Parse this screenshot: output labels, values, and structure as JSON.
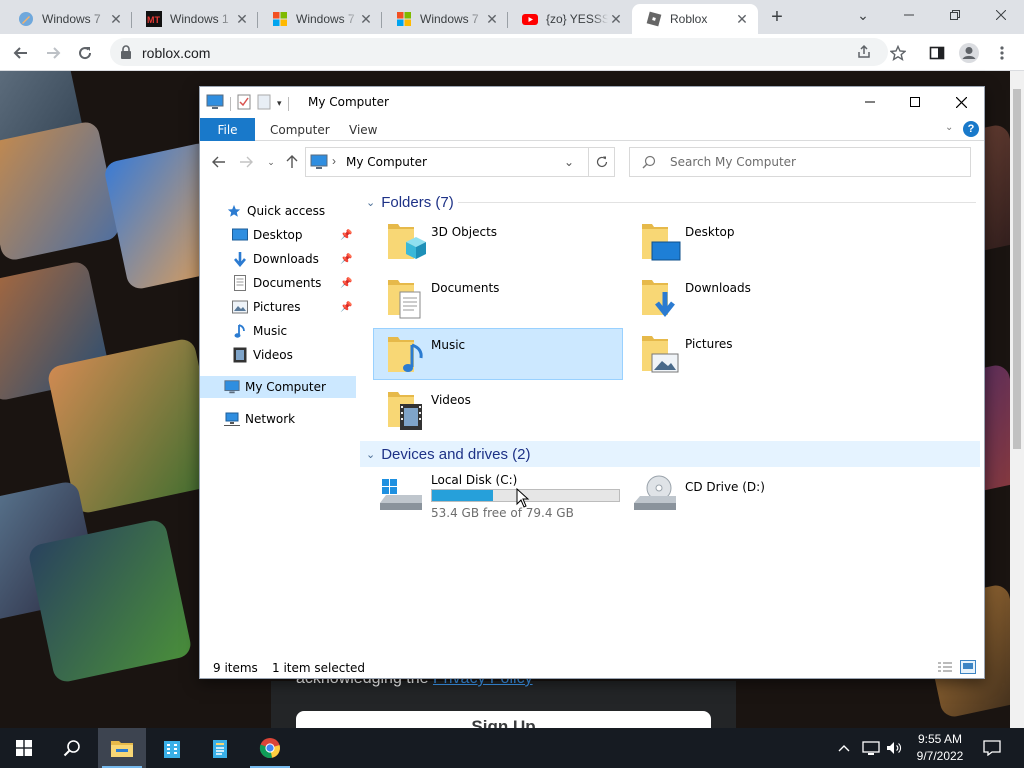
{
  "browser": {
    "tabs": [
      {
        "label": "Windows 7",
        "icon": "pencil-favicon-icon"
      },
      {
        "label": "Windows 1",
        "icon": "mt-favicon-icon"
      },
      {
        "label": "Windows 7",
        "icon": "windows-favicon-icon"
      },
      {
        "label": "Windows 7",
        "icon": "windows-favicon-icon"
      },
      {
        "label": "{zo} YESSS",
        "icon": "youtube-favicon-icon"
      },
      {
        "label": "Roblox",
        "icon": "roblox-favicon-icon",
        "active": true
      }
    ],
    "url": "roblox.com"
  },
  "page": {
    "signup_text": "acknowledging the ",
    "privacy_link": "Privacy Policy",
    "signup_button": "Sign Up"
  },
  "explorer": {
    "title": "My Computer",
    "ribbon_tabs": {
      "file": "File",
      "computer": "Computer",
      "view": "View"
    },
    "address": "My Computer",
    "search_placeholder": "Search My Computer",
    "nav": {
      "quick_access": "Quick access",
      "desktop": "Desktop",
      "downloads": "Downloads",
      "documents": "Documents",
      "pictures": "Pictures",
      "music": "Music",
      "videos": "Videos",
      "my_computer": "My Computer",
      "network": "Network"
    },
    "folders_header": "Folders (7)",
    "folders": [
      {
        "name": "3D Objects"
      },
      {
        "name": "Desktop"
      },
      {
        "name": "Documents"
      },
      {
        "name": "Downloads"
      },
      {
        "name": "Music",
        "selected": true
      },
      {
        "name": "Pictures"
      },
      {
        "name": "Videos"
      }
    ],
    "drives_header": "Devices and drives (2)",
    "drives": [
      {
        "name": "Local Disk (C:)",
        "free": "53.4 GB free of 79.4 GB",
        "used_fraction": 0.327
      },
      {
        "name": "CD Drive (D:)"
      }
    ],
    "status": {
      "items": "9 items",
      "selected": "1 item selected"
    }
  },
  "taskbar": {
    "time": "9:55 AM",
    "date": "9/7/2022"
  },
  "colors": {
    "accent": "#1979ca",
    "selection": "#cce8ff",
    "drive_bar": "#26a0da",
    "folder": "#f8d775",
    "taskbar": "#161b22"
  }
}
